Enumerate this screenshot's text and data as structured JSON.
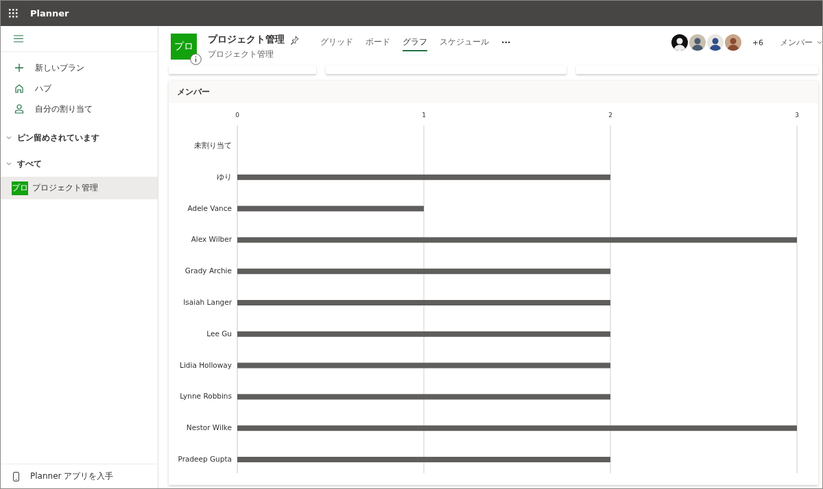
{
  "app_bar": {
    "title": "Planner"
  },
  "sidebar": {
    "items": [
      {
        "label": "新しいプラン",
        "kind": "new"
      },
      {
        "label": "ハブ",
        "kind": "hub"
      },
      {
        "label": "自分の割り当て",
        "kind": "assigned"
      }
    ],
    "sections": [
      {
        "label": "ピン留めされています"
      },
      {
        "label": "すべて",
        "plans": [
          {
            "badge": "プロ",
            "name": "プロジェクト管理",
            "selected": true
          }
        ]
      }
    ],
    "footer": "Planner アプリを入手"
  },
  "plan": {
    "badge": "プロ",
    "title": "プロジェクト管理",
    "subtitle": "プロジェクト管理"
  },
  "tabs": [
    {
      "label": "グリッド",
      "selected": false
    },
    {
      "label": "ボード",
      "selected": false
    },
    {
      "label": "グラフ",
      "selected": true
    },
    {
      "label": "スケジュール",
      "selected": false
    }
  ],
  "more": "···",
  "members": {
    "extra": "+6",
    "label": "メンバー"
  },
  "panel": {
    "title": "メンバー",
    "chart_data": {
      "type": "bar",
      "orientation": "horizontal",
      "categories": [
        "未割り当て",
        "ゆり",
        "Adele Vance",
        "Alex Wilber",
        "Grady Archie",
        "Isaiah Langer",
        "Lee Gu",
        "Lidia Holloway",
        "Lynne Robbins",
        "Nestor Wilke",
        "Pradeep Gupta"
      ],
      "series": [
        {
          "color": "#605e5c",
          "values": [
            0,
            2,
            1,
            3,
            2,
            2,
            2,
            2,
            2,
            3,
            2
          ]
        }
      ],
      "xlim": [
        0,
        3
      ],
      "xticks": [
        0,
        1,
        2,
        3
      ]
    }
  }
}
